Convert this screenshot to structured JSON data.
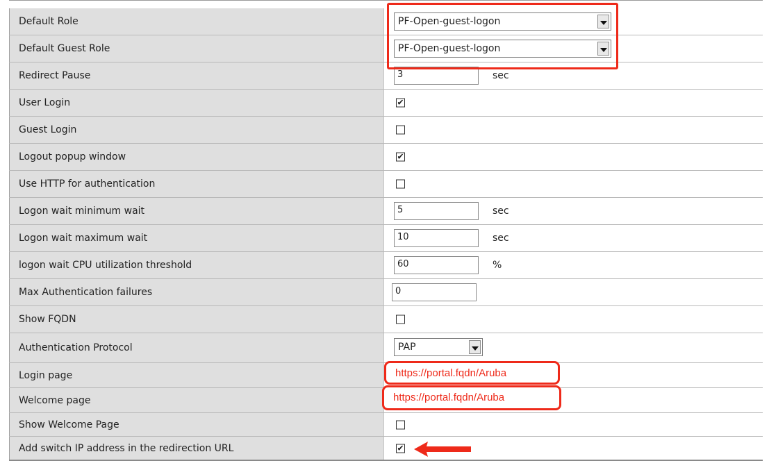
{
  "rows": [
    {
      "label": "Default Role",
      "type": "select",
      "value": "PF-Open-guest-logon"
    },
    {
      "label": "Default Guest Role",
      "type": "select",
      "value": "PF-Open-guest-logon"
    },
    {
      "label": "Redirect Pause",
      "type": "text",
      "value": "3",
      "unit": "sec"
    },
    {
      "label": "User Login",
      "type": "checkbox",
      "checked": true
    },
    {
      "label": "Guest Login",
      "type": "checkbox",
      "checked": false
    },
    {
      "label": "Logout popup window",
      "type": "checkbox",
      "checked": true
    },
    {
      "label": "Use HTTP for authentication",
      "type": "checkbox",
      "checked": false
    },
    {
      "label": "Logon wait minimum wait",
      "type": "text",
      "value": "5",
      "unit": "sec"
    },
    {
      "label": "Logon wait maximum wait",
      "type": "text",
      "value": "10",
      "unit": "sec"
    },
    {
      "label": "logon wait CPU utilization threshold",
      "type": "text",
      "value": "60",
      "unit": "%"
    },
    {
      "label": "Max Authentication failures",
      "type": "text",
      "value": "0"
    },
    {
      "label": "Show FQDN",
      "type": "checkbox",
      "checked": false
    },
    {
      "label": "Authentication Protocol",
      "type": "select",
      "value": "PAP"
    },
    {
      "label": "Login page",
      "type": "url",
      "value": "https://portal.fqdn/Aruba"
    },
    {
      "label": "Welcome page",
      "type": "url",
      "value": "https://portal.fqdn/Aruba"
    },
    {
      "label": "Show Welcome Page",
      "type": "checkbox",
      "checked": false
    },
    {
      "label": "Add switch IP address in the redirection URL",
      "type": "checkbox",
      "checked": true
    }
  ],
  "check_glyph": "✔",
  "highlight_color": "#ee2a1a",
  "annotation_icon": "red-arrow-left-icon"
}
